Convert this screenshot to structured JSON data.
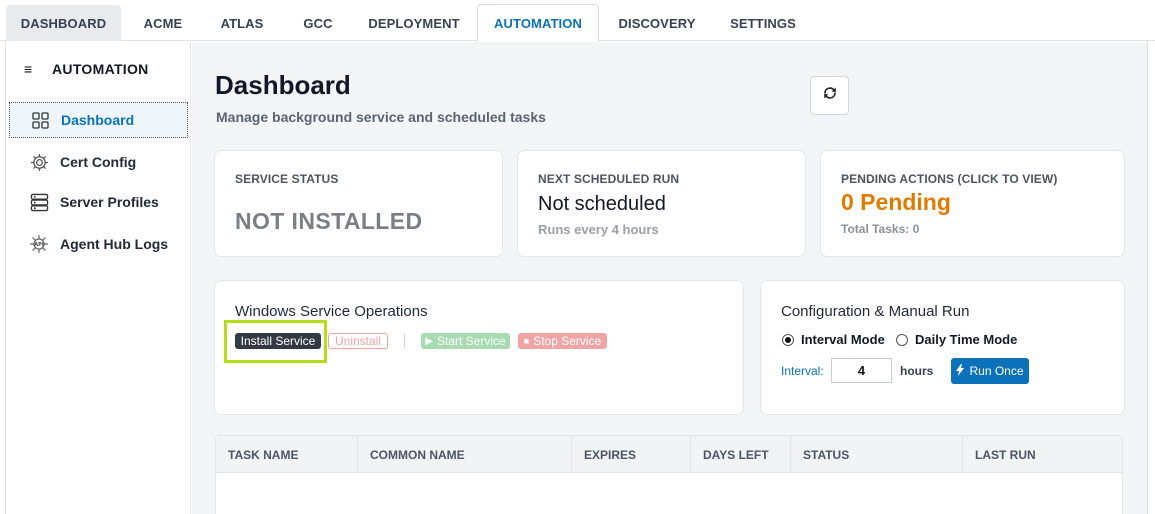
{
  "top_tabs": [
    "DASHBOARD",
    "ACME",
    "ATLAS",
    "GCC",
    "DEPLOYMENT",
    "AUTOMATION",
    "DISCOVERY",
    "SETTINGS"
  ],
  "active_tab": "AUTOMATION",
  "sidebar": {
    "title": "AUTOMATION",
    "items": [
      {
        "label": "Dashboard",
        "icon": "grid-icon",
        "active": true
      },
      {
        "label": "Cert Config",
        "icon": "gear-icon"
      },
      {
        "label": "Server Profiles",
        "icon": "server-icon"
      },
      {
        "label": "Agent Hub Logs",
        "icon": "api-hub-icon"
      }
    ]
  },
  "header": {
    "title": "Dashboard",
    "subtitle": "Manage background service and scheduled tasks",
    "refresh_icon": "refresh-icon"
  },
  "cards": {
    "service_status": {
      "label": "SERVICE STATUS",
      "value": "NOT INSTALLED"
    },
    "next_run": {
      "label": "NEXT SCHEDULED RUN",
      "value": "Not scheduled",
      "sub": "Runs every 4 hours"
    },
    "pending": {
      "label": "PENDING ACTIONS (CLICK TO VIEW)",
      "value": "0 Pending",
      "sub": "Total Tasks: 0"
    }
  },
  "service_ops": {
    "title": "Windows Service Operations",
    "install": "Install Service",
    "uninstall": "Uninstall",
    "start": "Start Service",
    "stop": "Stop Service"
  },
  "config": {
    "title": "Configuration & Manual Run",
    "interval_mode": "Interval Mode",
    "daily_mode": "Daily Time Mode",
    "selected_mode": "Interval Mode",
    "interval_label": "Interval:",
    "interval_value": "4",
    "hours": "hours",
    "run_once": "Run Once"
  },
  "table": {
    "columns": [
      "TASK NAME",
      "COMMON NAME",
      "EXPIRES",
      "DAYS LEFT",
      "STATUS",
      "LAST RUN"
    ]
  },
  "colors": {
    "accent": "#0b72b9",
    "pending": "#e07b00",
    "highlight": "#b6dd19"
  }
}
